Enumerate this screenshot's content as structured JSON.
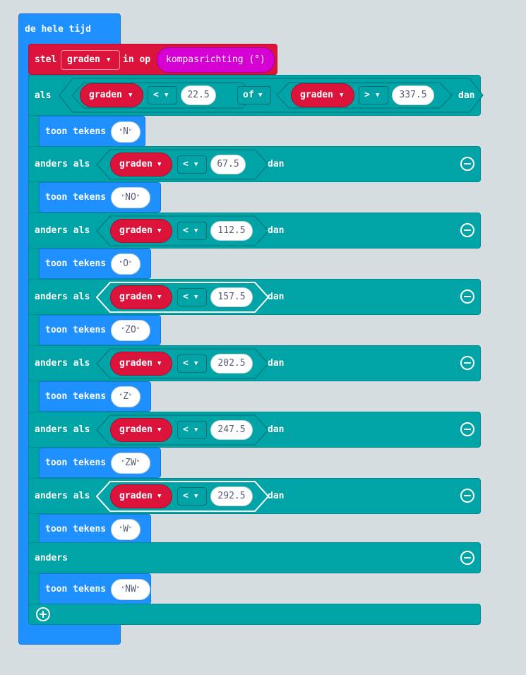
{
  "forever": {
    "label": "de hele tijd"
  },
  "set": {
    "label": "stel",
    "variable": "graden",
    "to_label": "in op",
    "value": "kompasrichting (°)"
  },
  "first_if": {
    "label": "als",
    "left": {
      "variable": "graden",
      "operator": "<",
      "value": "22.5"
    },
    "joiner": "of",
    "right": {
      "variable": "graden",
      "operator": ">",
      "value": "337.5"
    },
    "then": "dan",
    "show_label": "toon tekens",
    "show_value": "N"
  },
  "branches": [
    {
      "label": "anders als",
      "variable": "graden",
      "operator": "<",
      "value": "67.5",
      "then": "dan",
      "show_label": "toon tekens",
      "show_value": "NO"
    },
    {
      "label": "anders als",
      "variable": "graden",
      "operator": "<",
      "value": "112.5",
      "then": "dan",
      "show_label": "toon tekens",
      "show_value": "O"
    },
    {
      "label": "anders als",
      "variable": "graden",
      "operator": "<",
      "value": "157.5",
      "then": "dan",
      "show_label": "toon tekens",
      "show_value": "ZO"
    },
    {
      "label": "anders als",
      "variable": "graden",
      "operator": "<",
      "value": "202.5",
      "then": "dan",
      "show_label": "toon tekens",
      "show_value": "Z"
    },
    {
      "label": "anders als",
      "variable": "graden",
      "operator": "<",
      "value": "247.5",
      "then": "dan",
      "show_label": "toon tekens",
      "show_value": "ZW"
    },
    {
      "label": "anders als",
      "variable": "graden",
      "operator": "<",
      "value": "292.5",
      "then": "dan",
      "show_label": "toon tekens",
      "show_value": "W"
    }
  ],
  "else": {
    "label": "anders",
    "show_label": "toon tekens",
    "show_value": "NW"
  },
  "icons": {
    "remove": "minus-circle-icon",
    "add": "plus-circle-icon",
    "dropdown": "caret-down-icon"
  },
  "colors": {
    "forever": "#1e90ff",
    "variables": "#dc143c",
    "logic": "#00a4a6",
    "input": "#d400d4",
    "workspace": "#ecf0f1"
  }
}
